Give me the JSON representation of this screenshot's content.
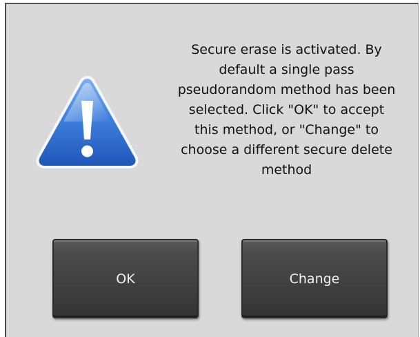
{
  "dialog": {
    "icon": "warning-icon",
    "message": "Secure erase is activated. By\ndefault a single pass\npseudorandom method has been\nselected. Click \"OK\" to accept\nthis method, or \"Change\" to\nchoose a different secure delete\nmethod"
  },
  "buttons": {
    "ok_label": "OK",
    "change_label": "Change"
  },
  "colors": {
    "dialog_background": "#d9d9d9",
    "button_background": "#3d3d3d",
    "button_text": "#f2f2f2",
    "icon_blue": "#2f6fd6"
  }
}
